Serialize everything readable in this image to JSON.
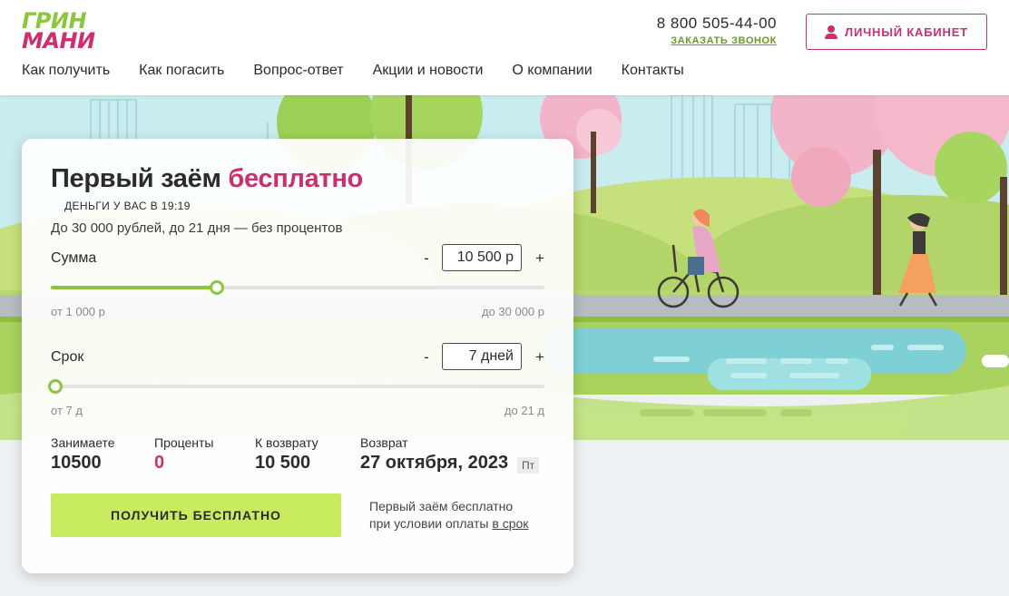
{
  "brand": {
    "line1": "ГРИН",
    "line2": "МАНИ"
  },
  "nav": [
    "Как получить",
    "Как погасить",
    "Вопрос-ответ",
    "Акции и новости",
    "О компании",
    "Контакты"
  ],
  "contact": {
    "phone": "8 800 505-44-00",
    "callback": "ЗАКАЗАТЬ ЗВОНОК"
  },
  "cabinet": {
    "label": "ЛИЧНЫЙ КАБИНЕТ",
    "icon": "user-icon"
  },
  "calculator": {
    "title_main": "Первый заём",
    "title_accent": "бесплатно",
    "money_time": "ДЕНЬГИ У ВАС В 19:19",
    "subtitle": "До 30 000 рублей, до 21 дня — без процентов",
    "amount": {
      "label": "Сумма",
      "minus": "-",
      "plus": "+",
      "value": "10 500 р",
      "min_label": "от 1 000 р",
      "max_label": "до 30 000 р",
      "min": 1000,
      "max": 30000,
      "current": 10500
    },
    "term": {
      "label": "Срок",
      "minus": "-",
      "plus": "+",
      "value": "7 дней",
      "min_label": "от 7 д",
      "max_label": "до 21 д",
      "min": 7,
      "max": 21,
      "current": 7
    },
    "summary": {
      "borrow_label": "Занимаете",
      "borrow_value": "10500",
      "interest_label": "Проценты",
      "interest_value": "0",
      "return_label": "К возврату",
      "return_value": "10 500",
      "date_label": "Возврат",
      "date_value": "27 октября, 2023",
      "weekday": "Пт"
    },
    "cta": "ПОЛУЧИТЬ БЕСПЛАТНО",
    "note_line1": "Первый заём бесплатно",
    "note_line2_prefix": "при условии оплаты ",
    "note_link": "в срок"
  },
  "colors": {
    "brand_green": "#8cc63f",
    "brand_pink": "#cc2f6e",
    "cta_green": "#c8eb5f"
  }
}
